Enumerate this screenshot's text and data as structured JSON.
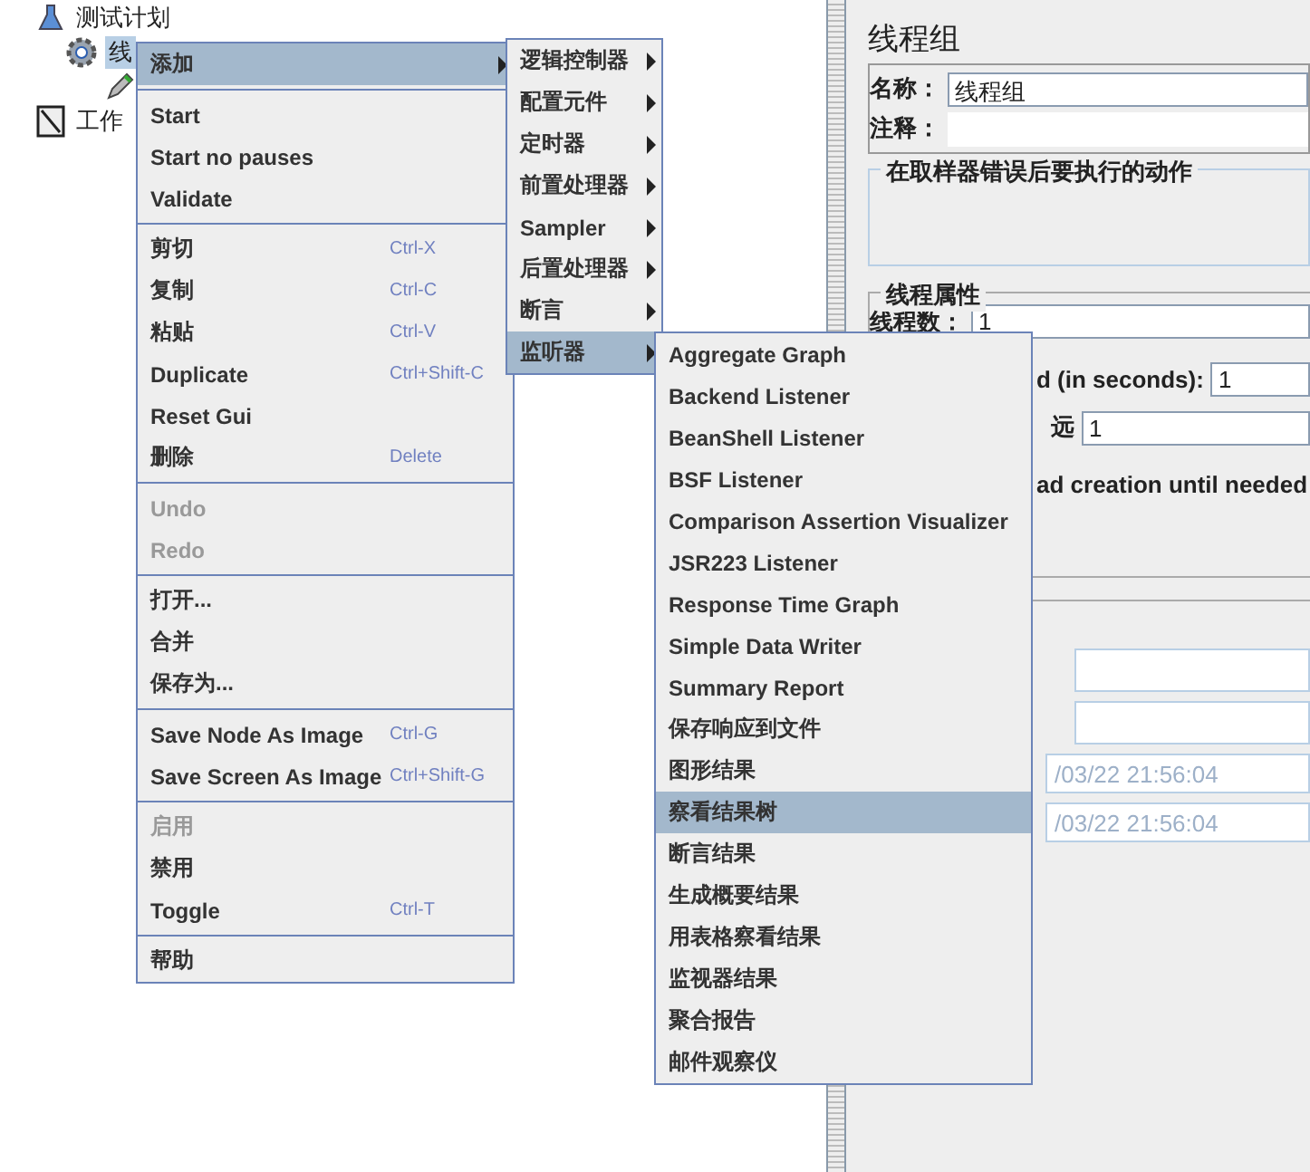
{
  "tree": [
    {
      "label": "测试计划",
      "kind": "plan",
      "selected": false,
      "children": [
        {
          "label": "线",
          "kind": "thread-group",
          "selected": true,
          "children": [
            {
              "kind": "sampler"
            }
          ]
        }
      ]
    },
    {
      "label": "工作",
      "kind": "workbench",
      "selected": false
    }
  ],
  "context_menu": {
    "groups": [
      [
        {
          "label": "添加",
          "submenu": true,
          "disabled": false,
          "selected": true
        }
      ],
      [
        {
          "label": "Start",
          "submenu": false,
          "disabled": false,
          "selected": false
        },
        {
          "label": "Start no pauses",
          "submenu": false,
          "disabled": false,
          "selected": false
        },
        {
          "label": "Validate",
          "submenu": false,
          "disabled": false,
          "selected": false
        }
      ],
      [
        {
          "label": "剪切",
          "shortcut": "Ctrl-X",
          "submenu": false,
          "disabled": false,
          "selected": false
        },
        {
          "label": "复制",
          "shortcut": "Ctrl-C",
          "submenu": false,
          "disabled": false,
          "selected": false
        },
        {
          "label": "粘贴",
          "shortcut": "Ctrl-V",
          "submenu": false,
          "disabled": false,
          "selected": false
        },
        {
          "label": "Duplicate",
          "shortcut": "Ctrl+Shift-C",
          "submenu": false,
          "disabled": false,
          "selected": false
        },
        {
          "label": "Reset Gui",
          "submenu": false,
          "disabled": false,
          "selected": false
        },
        {
          "label": "删除",
          "shortcut": "Delete",
          "submenu": false,
          "disabled": false,
          "selected": false
        }
      ],
      [
        {
          "label": "Undo",
          "submenu": false,
          "disabled": true,
          "selected": false
        },
        {
          "label": "Redo",
          "submenu": false,
          "disabled": true,
          "selected": false
        }
      ],
      [
        {
          "label": "打开...",
          "submenu": false,
          "disabled": false,
          "selected": false
        },
        {
          "label": "合并",
          "submenu": false,
          "disabled": false,
          "selected": false
        },
        {
          "label": "保存为...",
          "submenu": false,
          "disabled": false,
          "selected": false
        }
      ],
      [
        {
          "label": "Save Node As Image",
          "shortcut": "Ctrl-G",
          "submenu": false,
          "disabled": false,
          "selected": false
        },
        {
          "label": "Save Screen As Image",
          "shortcut": "Ctrl+Shift-G",
          "submenu": false,
          "disabled": false,
          "selected": false
        }
      ],
      [
        {
          "label": "启用",
          "submenu": false,
          "disabled": true,
          "selected": false
        },
        {
          "label": "禁用",
          "submenu": false,
          "disabled": false,
          "selected": false
        },
        {
          "label": "Toggle",
          "shortcut": "Ctrl-T",
          "submenu": false,
          "disabled": false,
          "selected": false
        }
      ],
      [
        {
          "label": "帮助",
          "submenu": false,
          "disabled": false,
          "selected": false
        }
      ]
    ]
  },
  "add_submenu": {
    "items": [
      {
        "label": "逻辑控制器",
        "submenu": true,
        "selected": false
      },
      {
        "label": "配置元件",
        "submenu": true,
        "selected": false
      },
      {
        "label": "定时器",
        "submenu": true,
        "selected": false
      },
      {
        "label": "前置处理器",
        "submenu": true,
        "selected": false
      },
      {
        "label": "Sampler",
        "submenu": true,
        "selected": false
      },
      {
        "label": "后置处理器",
        "submenu": true,
        "selected": false
      },
      {
        "label": "断言",
        "submenu": true,
        "selected": false
      },
      {
        "label": "监听器",
        "submenu": true,
        "selected": true
      }
    ]
  },
  "listener_submenu": {
    "items": [
      {
        "label": "Aggregate Graph",
        "selected": false
      },
      {
        "label": "Backend Listener",
        "selected": false
      },
      {
        "label": "BeanShell Listener",
        "selected": false
      },
      {
        "label": "BSF Listener",
        "selected": false
      },
      {
        "label": "Comparison Assertion Visualizer",
        "selected": false
      },
      {
        "label": "JSR223 Listener",
        "selected": false
      },
      {
        "label": "Response Time Graph",
        "selected": false
      },
      {
        "label": "Simple Data Writer",
        "selected": false
      },
      {
        "label": "Summary Report",
        "selected": false
      },
      {
        "label": "保存响应到文件",
        "selected": false
      },
      {
        "label": "图形结果",
        "selected": false
      },
      {
        "label": "察看结果树",
        "selected": true
      },
      {
        "label": "断言结果",
        "selected": false
      },
      {
        "label": "生成概要结果",
        "selected": false
      },
      {
        "label": "用表格察看结果",
        "selected": false
      },
      {
        "label": "监视器结果",
        "selected": false
      },
      {
        "label": "聚合报告",
        "selected": false
      },
      {
        "label": "邮件观察仪",
        "selected": false
      }
    ]
  },
  "editor": {
    "title": "线程组",
    "name_label": "名称：",
    "name_value": "线程组",
    "comment_label": "注释：",
    "error_action_group": "在取样器错误后要执行的动作",
    "thread_group": "线程属性",
    "thread_count_label": "线程数：",
    "thread_count_value": "1",
    "ramp_label": "d (in seconds):",
    "ramp_value": "1",
    "loop_label": "远",
    "loop_value": "1",
    "delay_label": "ad creation until needed",
    "timestamps": [
      "/03/22 21:56:04",
      "/03/22 21:56:04"
    ]
  }
}
